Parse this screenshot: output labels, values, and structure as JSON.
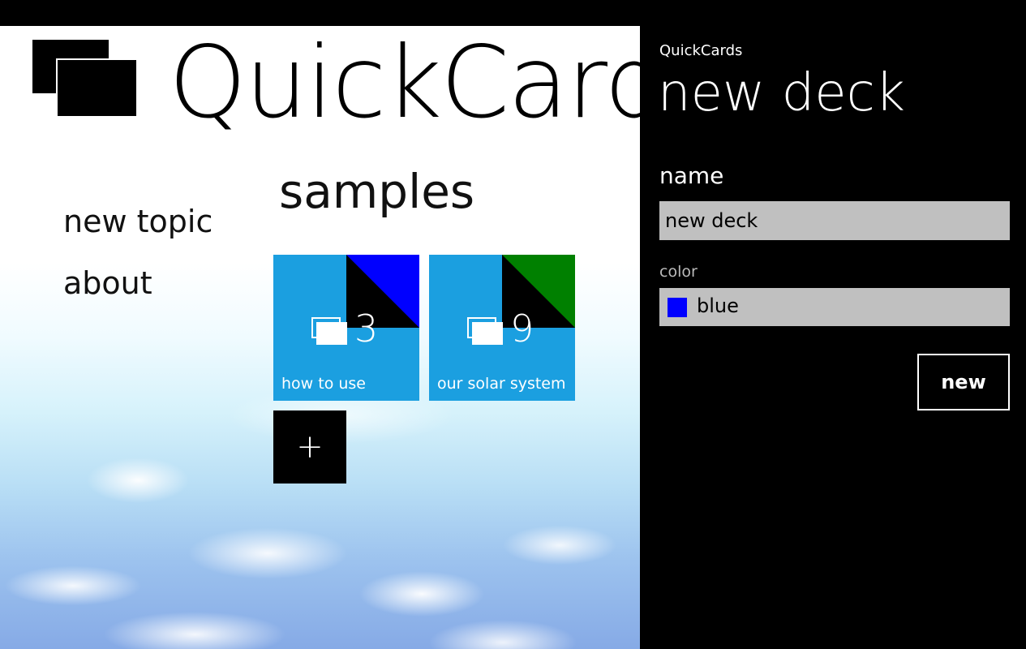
{
  "app": {
    "title": "QuickCards"
  },
  "nav": {
    "items": [
      {
        "label": "new topic"
      },
      {
        "label": "about"
      }
    ]
  },
  "section": {
    "title": "samples"
  },
  "tiles": [
    {
      "count": "3",
      "label": "how to use",
      "accent": "#0000ff",
      "icon": "deck-icon"
    },
    {
      "count": "9",
      "label": "our solar system",
      "accent": "#008000",
      "icon": "deck-icon"
    }
  ],
  "add_tile": {
    "symbol": "+"
  },
  "panel": {
    "app_name": "QuickCards",
    "title": "new deck",
    "name_label": "name",
    "name_value": "new deck",
    "color_label": "color",
    "color_value": "blue",
    "color_swatch": "#0000ff",
    "button_label": "new"
  },
  "colors": {
    "tile_bg": "#1b9fe0",
    "panel_bg": "#000000",
    "input_bg": "#c0c0c0"
  }
}
